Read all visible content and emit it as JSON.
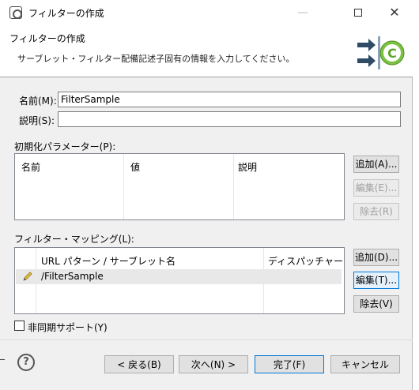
{
  "window": {
    "title": "フィルターの作成"
  },
  "header": {
    "title": "フィルターの作成",
    "description": "サーブレット・フィルター配備記述子固有の情報を入力してください。"
  },
  "form": {
    "name_label": "名前(M):",
    "name_value": "FilterSample",
    "description_label": "説明(S):",
    "description_value": ""
  },
  "init_params": {
    "label": "初期化パラメーター(P):",
    "columns": [
      "名前",
      "値",
      "説明"
    ],
    "buttons": {
      "add": "追加(A)...",
      "edit": "編集(E)...",
      "remove": "除去(R)"
    }
  },
  "mappings": {
    "label": "フィルター・マッピング(L):",
    "columns": [
      "URL パターン / サーブレット名",
      "ディスパッチャー"
    ],
    "rows": [
      {
        "pattern": "/FilterSample",
        "dispatcher": ""
      }
    ],
    "buttons": {
      "add": "追加(D)...",
      "edit": "編集(T)...",
      "remove": "除去(V)"
    }
  },
  "async": {
    "label": "非同期サポート(Y)",
    "checked": false
  },
  "footer": {
    "back": "< 戻る(B)",
    "next": "次へ(N) >",
    "finish": "完了(F)",
    "cancel": "キャンセル"
  }
}
